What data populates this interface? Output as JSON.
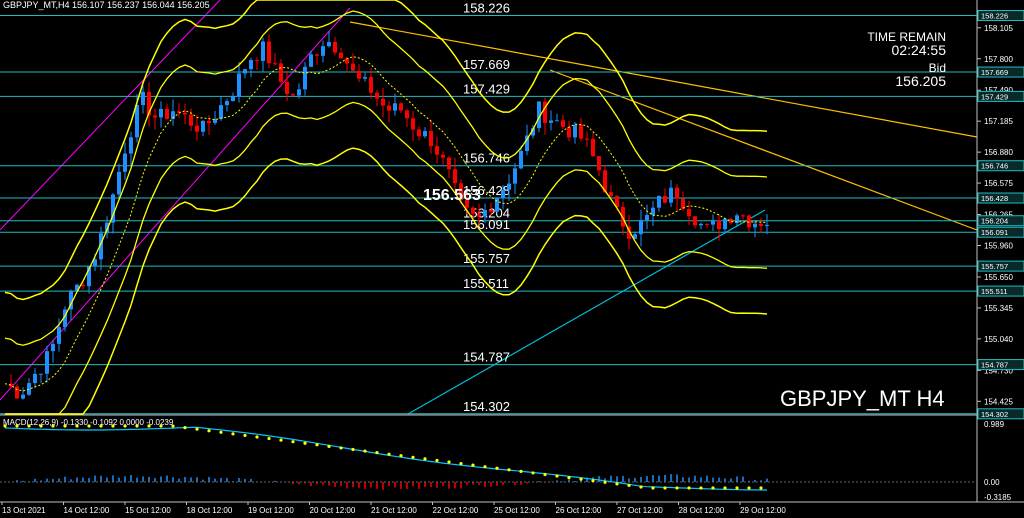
{
  "header": {
    "symbol_info": "GBPJPY_MT,H4   156.107 156.237 156.044 156.205"
  },
  "info_panel": {
    "time_remain_label": "TIME REMAIN",
    "time_remain_value": "02:24:55",
    "bid_label": "Bid",
    "bid_value": "156.205"
  },
  "watermark": "GBPJPY_MT H4",
  "current_price_label": "156.563",
  "macd_header": "MACD(12,26,9) -0.1330 -0.1092 0.0000 -0.0239",
  "colors": {
    "background": "#000000",
    "bull": "#1e90ff",
    "bear": "#ff0000",
    "bands": "#ffff00",
    "trendline": "#ffc000",
    "channel": "#ff00ff",
    "support_line": "#00bcd4",
    "hline": "#1fbcc4",
    "macd_signal": "#ffff00",
    "macd_line": "#00c8ff"
  },
  "price_axis": {
    "ticks": [
      "158.105",
      "157.800",
      "157.490",
      "157.185",
      "156.880",
      "156.575",
      "156.265",
      "155.960",
      "155.650",
      "155.345",
      "155.040",
      "154.730",
      "154.425"
    ],
    "range": [
      154.3,
      158.3
    ]
  },
  "horizontal_levels": [
    {
      "value": "158.226",
      "price": 158.226
    },
    {
      "value": "157.669",
      "price": 157.669
    },
    {
      "value": "157.429",
      "price": 157.429
    },
    {
      "value": "156.746",
      "price": 156.746
    },
    {
      "value": "156.428",
      "price": 156.428
    },
    {
      "value": "156.204",
      "price": 156.204
    },
    {
      "value": "156.091",
      "price": 156.091
    },
    {
      "value": "155.757",
      "price": 155.757
    },
    {
      "value": "155.511",
      "price": 155.511
    },
    {
      "value": "154.787",
      "price": 154.787
    },
    {
      "value": "154.302",
      "price": 154.302
    }
  ],
  "macd_axis": {
    "ticks": [
      "0.989",
      "0.00",
      "-0.3185"
    ]
  },
  "time_axis": {
    "labels": [
      "13 Oct 2021",
      "14 Oct 12:00",
      "15 Oct 12:00",
      "18 Oct 12:00",
      "19 Oct 12:00",
      "20 Oct 12:00",
      "21 Oct 12:00",
      "22 Oct 12:00",
      "25 Oct 12:00",
      "26 Oct 12:00",
      "27 Oct 12:00",
      "28 Oct 12:00",
      "29 Oct 12:00"
    ]
  }
}
